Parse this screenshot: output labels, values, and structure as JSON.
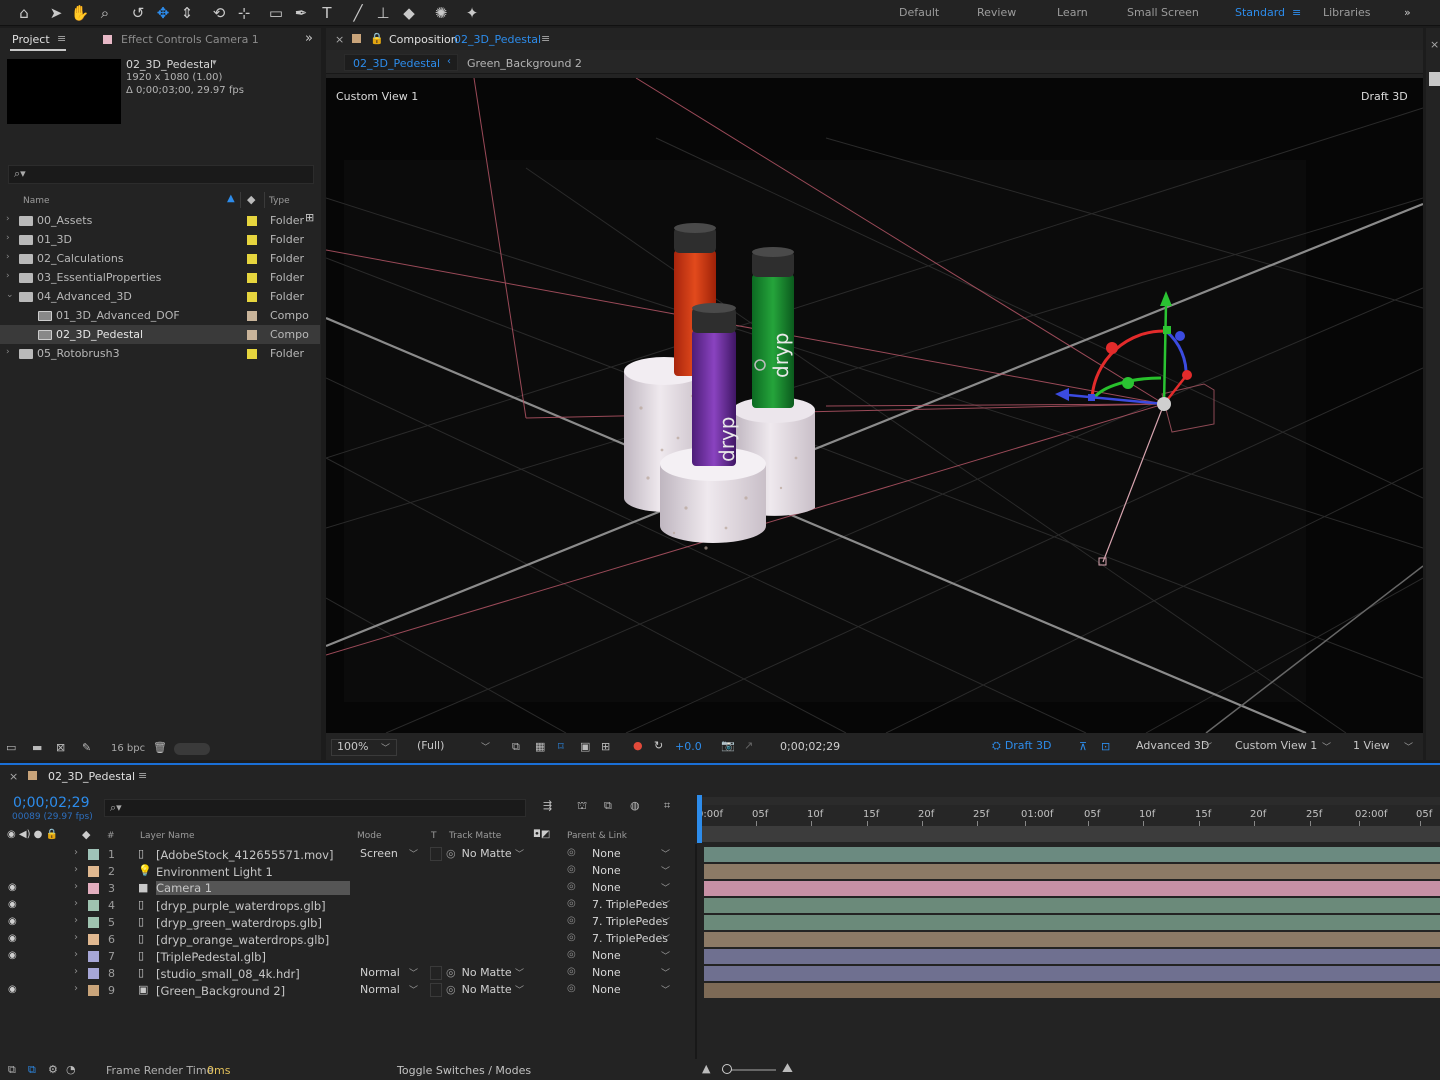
{
  "toolbar": {
    "tools": [
      "home-icon",
      "selection-tool-icon",
      "hand-tool-icon",
      "zoom-tool-icon",
      "orbit-camera-icon",
      "move-tool-icon",
      "dolly-tool-icon",
      "rotate-tool-icon",
      "pan-behind-icon",
      "rectangle-tool-icon",
      "pen-tool-icon",
      "type-tool-icon",
      "brush-tool-icon",
      "clone-stamp-icon",
      "eraser-icon",
      "roto-brush-icon",
      "puppet-pin-icon"
    ],
    "workspaces": [
      "Default",
      "Review",
      "Learn",
      "Small Screen",
      "Standard",
      "Libraries"
    ],
    "active_workspace": "Standard",
    "more": "»"
  },
  "project": {
    "tab_project": "Project",
    "tab_effects": "Effect Controls Camera 1",
    "expand": "»",
    "comp_name": "02_3D_Pedestal",
    "comp_size": "1920 x 1080 (1.00)",
    "comp_duration": "Δ 0;00;03;00, 29.97 fps",
    "search_placeholder": "",
    "col_name": "Name",
    "col_type": "Type",
    "items": [
      {
        "name": "00_Assets",
        "type": "Folder",
        "indent": 0,
        "kind": "folder",
        "label_color": "#e6d53e",
        "open": false
      },
      {
        "name": "01_3D",
        "type": "Folder",
        "indent": 0,
        "kind": "folder",
        "label_color": "#e6d53e",
        "open": false
      },
      {
        "name": "02_Calculations",
        "type": "Folder",
        "indent": 0,
        "kind": "folder",
        "label_color": "#e6d53e",
        "open": false
      },
      {
        "name": "03_EssentialProperties",
        "type": "Folder",
        "indent": 0,
        "kind": "folder",
        "label_color": "#e6d53e",
        "open": false
      },
      {
        "name": "04_Advanced_3D",
        "type": "Folder",
        "indent": 0,
        "kind": "folder",
        "label_color": "#e6d53e",
        "open": true
      },
      {
        "name": "01_3D_Advanced_DOF",
        "type": "Compo",
        "indent": 1,
        "kind": "comp",
        "label_color": "#c9b49a",
        "open": false
      },
      {
        "name": "02_3D_Pedestal",
        "type": "Compo",
        "indent": 1,
        "kind": "comp",
        "label_color": "#c9b49a",
        "open": false,
        "selected": true
      },
      {
        "name": "05_Rotobrush3",
        "type": "Folder",
        "indent": 0,
        "kind": "folder",
        "label_color": "#e6d53e",
        "open": false
      }
    ],
    "bpc": "16 bpc"
  },
  "composition": {
    "tab_label_prefix": "Composition",
    "tab_comp_name": "02_3D_Pedestal",
    "breadcrumb": [
      "02_3D_Pedestal",
      "Green_Background 2"
    ],
    "view_name": "Custom View 1",
    "renderer": "Draft 3D",
    "controls": {
      "zoom": "100%",
      "resolution": "(Full)",
      "exposure": "+0.0",
      "timecode": "0;00;02;29",
      "draft3d": "Draft 3D",
      "renderer": "Advanced 3D",
      "view": "Custom View 1",
      "layout": "1 View"
    },
    "bottle_texts": [
      "dryp",
      "dryp"
    ]
  },
  "timeline": {
    "tab": "02_3D_Pedestal",
    "timecode": "0;00;02;29",
    "frame_info": "00089 (29.97 fps)",
    "col_layer": "Layer Name",
    "col_mode": "Mode",
    "col_t": "T",
    "col_matte": "Track Matte",
    "col_parent": "Parent & Link",
    "col_num": "#",
    "ruler": [
      "0:00f",
      "05f",
      "10f",
      "15f",
      "20f",
      "25f",
      "01:00f",
      "05f",
      "10f",
      "15f",
      "20f",
      "25f",
      "02:00f",
      "05f"
    ],
    "layers": [
      {
        "num": "1",
        "name": "[AdobeStock_412655571.mov]",
        "label": "#9fc3b8",
        "mode": "Screen",
        "matte": "No Matte",
        "parent": "None",
        "bar": "#6b8a80",
        "eye": false,
        "kind": "footage"
      },
      {
        "num": "2",
        "name": "Environment Light 1",
        "label": "#e0b890",
        "mode": "",
        "matte": "",
        "parent": "None",
        "bar": "#8c7a66",
        "eye": false,
        "kind": "light"
      },
      {
        "num": "3",
        "name": "Camera 1",
        "label": "#e3aebf",
        "mode": "",
        "matte": "",
        "parent": "None",
        "bar": "#c790a5",
        "eye": true,
        "kind": "camera",
        "selected": true
      },
      {
        "num": "4",
        "name": "[dryp_purple_waterdrops.glb]",
        "label": "#9fc3b0",
        "mode": "",
        "matte": "",
        "parent": "7. TriplePedes",
        "bar": "#6b8a7a",
        "eye": true,
        "kind": "model"
      },
      {
        "num": "5",
        "name": "[dryp_green_waterdrops.glb]",
        "label": "#9fc3b0",
        "mode": "",
        "matte": "",
        "parent": "7. TriplePedes",
        "bar": "#6b8a7a",
        "eye": true,
        "kind": "model"
      },
      {
        "num": "6",
        "name": "[dryp_orange_waterdrops.glb]",
        "label": "#e0b890",
        "mode": "",
        "matte": "",
        "parent": "7. TriplePedes",
        "bar": "#8c7a66",
        "eye": true,
        "kind": "model"
      },
      {
        "num": "7",
        "name": "[TriplePedestal.glb]",
        "label": "#a6a6d6",
        "mode": "",
        "matte": "",
        "parent": "None",
        "bar": "#6f7090",
        "eye": true,
        "kind": "model"
      },
      {
        "num": "8",
        "name": "[studio_small_08_4k.hdr]",
        "label": "#a6a6d6",
        "mode": "Normal",
        "matte": "No Matte",
        "parent": "None",
        "bar": "#6f7090",
        "eye": false,
        "kind": "footage"
      },
      {
        "num": "9",
        "name": "[Green_Background 2]",
        "label": "#c9a47a",
        "mode": "Normal",
        "matte": "No Matte",
        "parent": "None",
        "bar": "#7d6a56",
        "eye": true,
        "kind": "comp"
      }
    ],
    "frame_render_label": "Frame Render Time",
    "frame_render_value": "0ms",
    "toggle": "Toggle Switches / Modes"
  }
}
